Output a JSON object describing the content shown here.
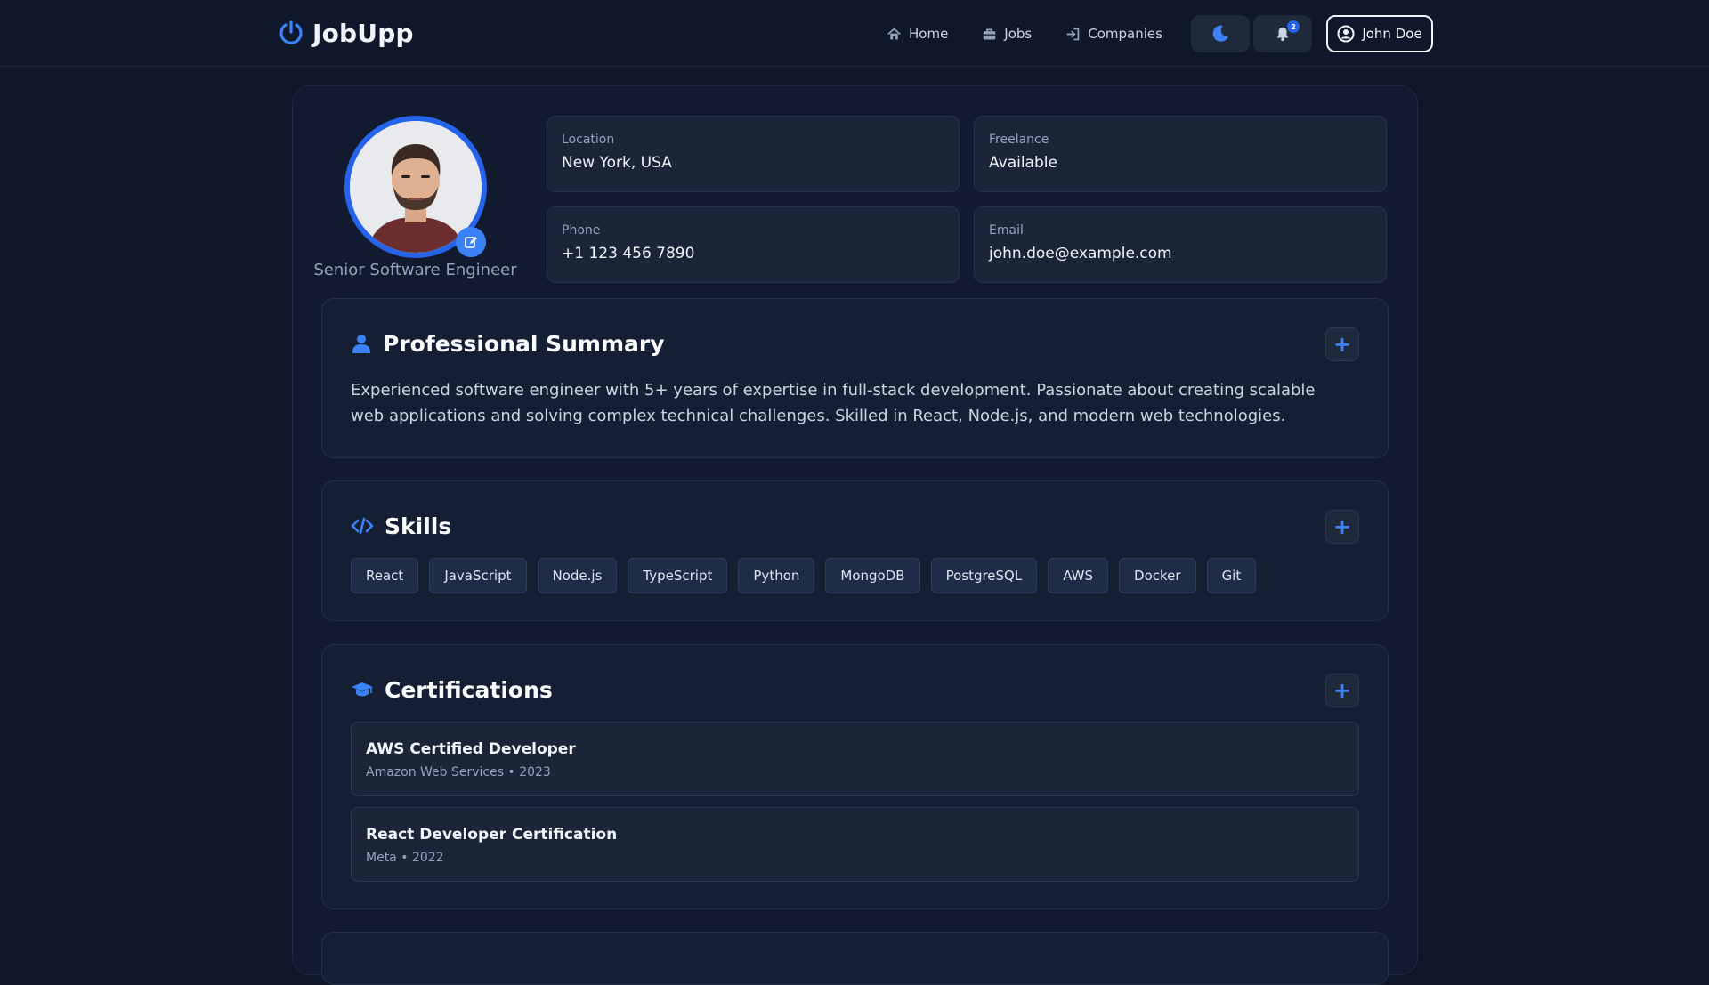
{
  "app": {
    "name": "JobUpp"
  },
  "nav": {
    "home": "Home",
    "jobs": "Jobs",
    "companies": "Companies",
    "notifications_count": "2",
    "user_name": "John Doe"
  },
  "profile": {
    "title": "Senior Software Engineer",
    "location_label": "Location",
    "location": "New York, USA",
    "freelance_label": "Freelance",
    "freelance": "Available",
    "phone_label": "Phone",
    "phone": "+1 123 456 7890",
    "email_label": "Email",
    "email": "john.doe@example.com"
  },
  "summary": {
    "heading": "Professional Summary",
    "add_label": "+",
    "text": "Experienced software engineer with 5+ years of expertise in full-stack development. Passionate about creating scalable web applications and solving complex technical challenges. Skilled in React, Node.js, and modern web technologies."
  },
  "skills": {
    "heading": "Skills",
    "add_label": "+",
    "items": [
      "React",
      "JavaScript",
      "Node.js",
      "TypeScript",
      "Python",
      "MongoDB",
      "PostgreSQL",
      "AWS",
      "Docker",
      "Git"
    ]
  },
  "certifications": {
    "heading": "Certifications",
    "add_label": "+",
    "items": [
      {
        "name": "AWS Certified Developer",
        "meta": "Amazon Web Services • 2023"
      },
      {
        "name": "React Developer Certification",
        "meta": "Meta • 2022"
      }
    ]
  },
  "colors": {
    "background": "#0f172a",
    "accent": "#3b82f6",
    "card": "#151f33"
  },
  "icons": {
    "brand": "power-icon",
    "home": "home-icon",
    "jobs": "briefcase-icon",
    "companies": "sign-in-icon",
    "theme": "moon-icon",
    "notifications": "bell-icon",
    "user": "user-circle-icon",
    "summary": "user-icon",
    "skills": "code-icon",
    "certifications": "graduation-cap-icon",
    "edit": "edit-icon"
  }
}
